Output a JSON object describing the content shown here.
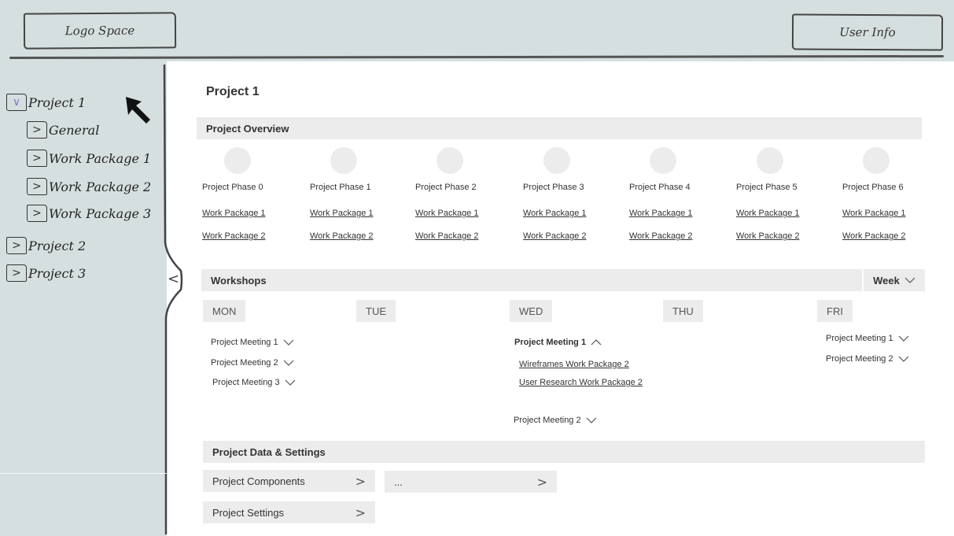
{
  "header": {
    "logo": "Logo Space",
    "user": "User Info"
  },
  "sidebar": {
    "collapse_glyph": "<",
    "items": [
      {
        "label": "Project 1",
        "toggle": "∨"
      },
      {
        "label": "General",
        "toggle": ">"
      },
      {
        "label": "Work Package 1",
        "toggle": ">"
      },
      {
        "label": "Work Package 2",
        "toggle": ">"
      },
      {
        "label": "Work Package 3",
        "toggle": ">"
      },
      {
        "label": "Project 2",
        "toggle": ">"
      },
      {
        "label": "Project 3",
        "toggle": ">"
      }
    ]
  },
  "main": {
    "title": "Project 1",
    "overview": {
      "title": "Project Overview",
      "phases": [
        {
          "label": "Project Phase 0",
          "wp1": "Work Package 1",
          "wp2": "Work Package 2"
        },
        {
          "label": "Project Phase 1",
          "wp1": "Work Package 1",
          "wp2": "Work Package 2"
        },
        {
          "label": "Project Phase 2",
          "wp1": "Work Package 1",
          "wp2": "Work Package 2"
        },
        {
          "label": "Project Phase 3",
          "wp1": "Work Package 1",
          "wp2": "Work Package 2"
        },
        {
          "label": "Project Phase 4",
          "wp1": "Work Package 1",
          "wp2": "Work Package 2"
        },
        {
          "label": "Project Phase 5",
          "wp1": "Work Package 1",
          "wp2": "Work Package 2"
        },
        {
          "label": "Project Phase 6",
          "wp1": "Work Package 1",
          "wp2": "Work Package 2"
        }
      ]
    },
    "workshops": {
      "title": "Workshops",
      "range": "Week",
      "days": [
        "MON",
        "TUE",
        "WED",
        "THU",
        "FRI"
      ],
      "mon": [
        "Project Meeting 1",
        "Project Meeting 2",
        "Project Meeting 3"
      ],
      "wed": {
        "expanded": "Project Meeting 1",
        "links": [
          "Wireframes Work Package 2",
          "User Research Work Package 2"
        ],
        "next": "Project Meeting 2"
      },
      "fri": [
        "Project Meeting 1",
        "Project Meeting 2"
      ]
    },
    "data_settings": {
      "title": "Project Data & Settings",
      "components": "Project Components",
      "more": "...",
      "settings": "Project Settings"
    }
  },
  "colors": {
    "panel": "#d6dfe0",
    "section": "#ececec",
    "toggle_open": "#8d6fc9"
  }
}
